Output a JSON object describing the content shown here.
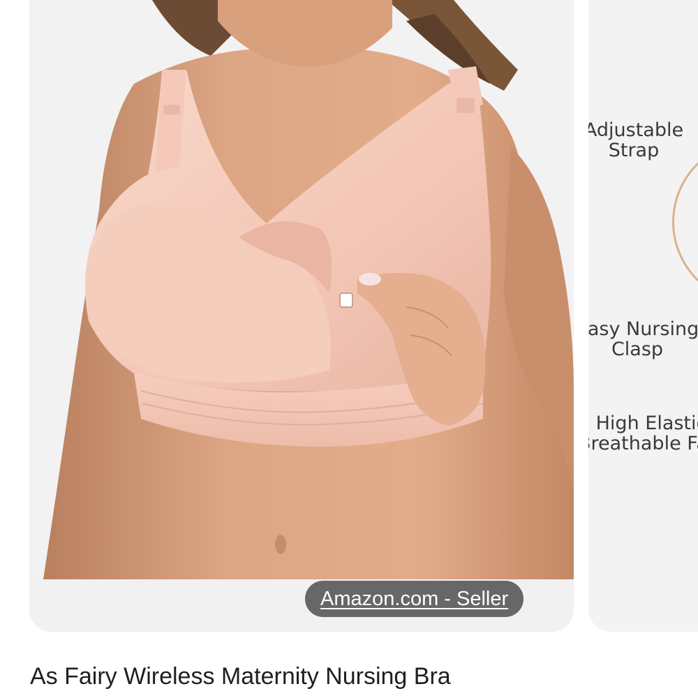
{
  "main_image": {
    "source_chip": "Amazon.com - Seller"
  },
  "side_image": {
    "features": [
      {
        "line1": "Adjustable",
        "line2": "Strap"
      },
      {
        "line1": "Easy Nursing",
        "line2": "Clasp"
      },
      {
        "line1": "High Elastic",
        "line2": "Breathable Fabric"
      }
    ]
  },
  "product": {
    "title": "As Fairy Wireless Maternity Nursing Bra"
  },
  "colors": {
    "card_background": "#f1f1f2",
    "chip_background": "#484848",
    "title_text": "#1f1f1f",
    "bra_fabric": "#f4c9b9",
    "skin": "#d9a27f"
  }
}
